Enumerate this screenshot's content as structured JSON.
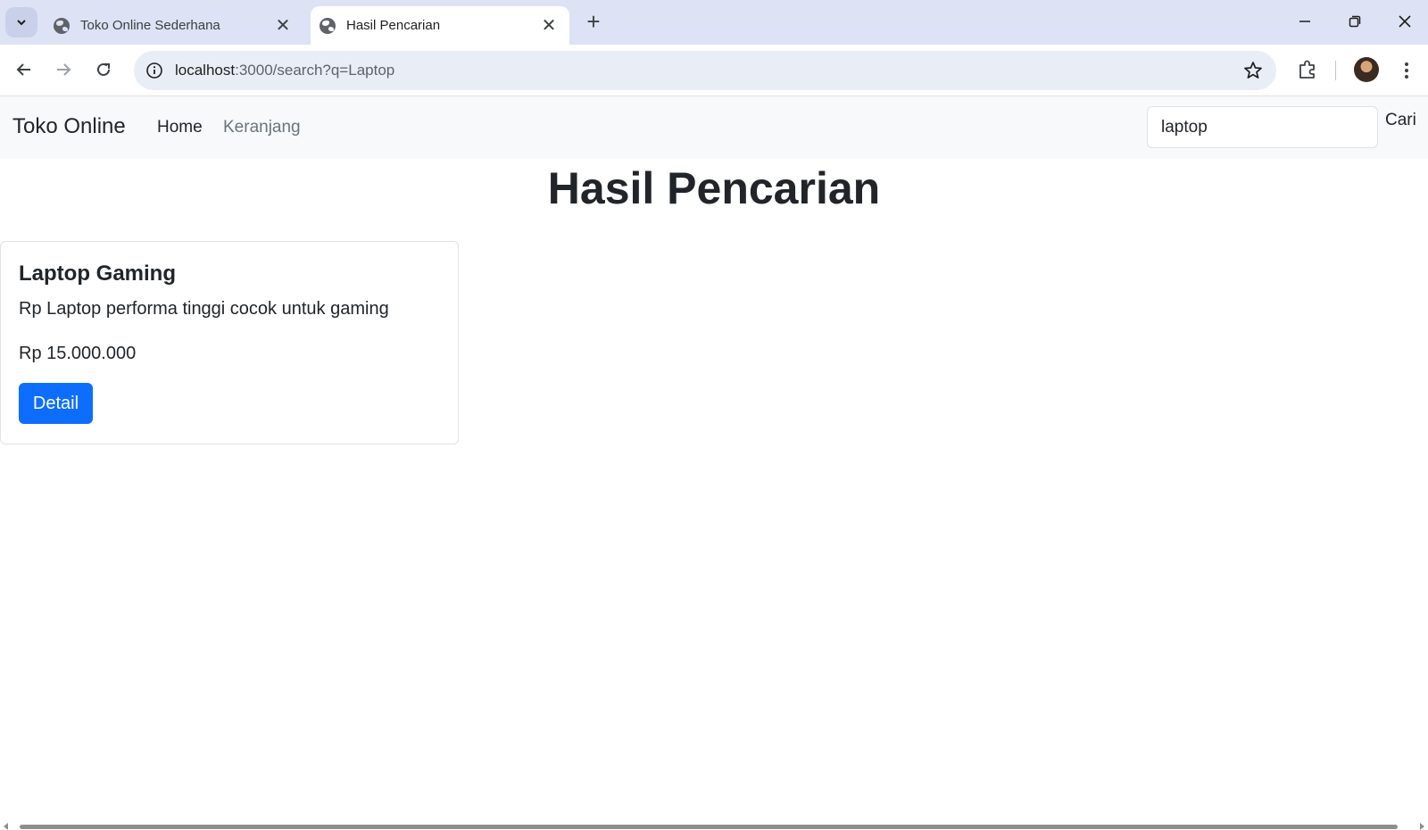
{
  "browser": {
    "tabs": [
      {
        "title": "Toko Online Sederhana",
        "active": false
      },
      {
        "title": "Hasil Pencarian",
        "active": true
      }
    ],
    "close_glyph": "✕",
    "new_tab_glyph": "+",
    "url_host": "localhost",
    "url_rest": ":3000/search?q=Laptop"
  },
  "navbar": {
    "brand": "Toko Online",
    "links": [
      "Home",
      "Keranjang"
    ],
    "search_value": "laptop",
    "search_button": "Cari"
  },
  "page": {
    "title": "Hasil Pencarian"
  },
  "results": [
    {
      "name": "Laptop Gaming",
      "description": "Rp Laptop performa tinggi cocok untuk gaming",
      "price": "Rp 15.000.000",
      "button": "Detail"
    }
  ],
  "colors": {
    "primary": "#0d6efd",
    "navbar_bg": "#f8f9fa",
    "tabstrip_bg": "#dde3f4"
  },
  "icons": {
    "tab_menu": "chevron-down-icon",
    "back": "arrow-left-icon",
    "forward": "arrow-right-icon",
    "reload": "reload-icon",
    "site_info": "info-icon",
    "bookmark": "star-icon",
    "extensions": "puzzle-icon",
    "menu": "kebab-menu-icon"
  }
}
